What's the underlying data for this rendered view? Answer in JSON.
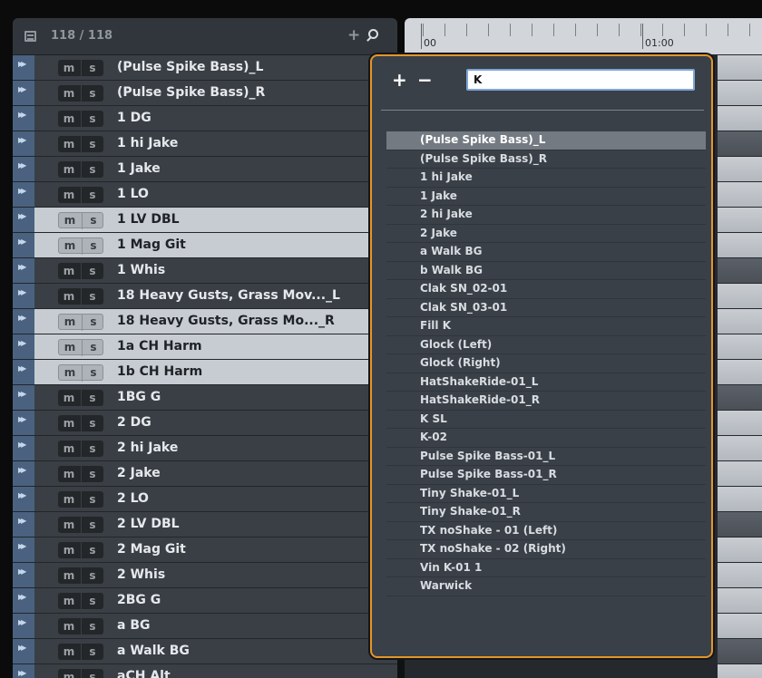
{
  "track_list": {
    "count_label": "118 / 118",
    "tracks": [
      {
        "name": "(Pulse Spike Bass)_L",
        "selected": false
      },
      {
        "name": "(Pulse Spike Bass)_R",
        "selected": false
      },
      {
        "name": "1 DG",
        "selected": false
      },
      {
        "name": "1 hi Jake",
        "selected": false
      },
      {
        "name": "1 Jake",
        "selected": false
      },
      {
        "name": "1 LO",
        "selected": false
      },
      {
        "name": "1 LV DBL",
        "selected": true
      },
      {
        "name": "1 Mag Git",
        "selected": true
      },
      {
        "name": "1 Whis",
        "selected": false
      },
      {
        "name": "18 Heavy Gusts, Grass Mov..._L",
        "selected": false
      },
      {
        "name": "18 Heavy Gusts, Grass Mo..._R",
        "selected": true
      },
      {
        "name": "1a CH Harm",
        "selected": true
      },
      {
        "name": "1b CH Harm",
        "selected": true
      },
      {
        "name": "1BG G",
        "selected": false
      },
      {
        "name": "2 DG",
        "selected": false
      },
      {
        "name": "2 hi Jake",
        "selected": false
      },
      {
        "name": "2 Jake",
        "selected": false
      },
      {
        "name": "2 LO",
        "selected": false
      },
      {
        "name": "2 LV DBL",
        "selected": false
      },
      {
        "name": "2 Mag Git",
        "selected": false
      },
      {
        "name": "2 Whis",
        "selected": false
      },
      {
        "name": "2BG G",
        "selected": false
      },
      {
        "name": "a BG",
        "selected": false
      },
      {
        "name": "a Walk BG",
        "selected": false
      },
      {
        "name": "aCH Alt",
        "selected": false
      }
    ],
    "mute_label": "m",
    "solo_label": "s"
  },
  "timeline": {
    "ruler_labels": [
      "00",
      "01:00"
    ]
  },
  "filter_popup": {
    "add_label": "+",
    "remove_label": "−",
    "filter_value": "K",
    "results": [
      "(Pulse Spike Bass)_L",
      "(Pulse Spike Bass)_R",
      "1 hi Jake",
      "1 Jake",
      "2 hi Jake",
      "2 Jake",
      "a Walk BG",
      "b Walk BG",
      "Clak SN_02-01",
      "Clak SN_03-01",
      "Fill K",
      "Glock (Left)",
      "Glock (Right)",
      "HatShakeRide-01_L",
      "HatShakeRide-01_R",
      "K SL",
      "K-02",
      "Pulse Spike Bass-01_L",
      "Pulse Spike Bass-01_R",
      "Tiny Shake-01_L",
      "Tiny Shake-01_R",
      "TX noShake - 01 (Left)",
      "TX noShake - 02 (Right)",
      "Vin K-01 1",
      "Warwick"
    ],
    "highlighted_index": 0
  },
  "colors": {
    "popup_border": "#e3962a",
    "selection_row": "#c7ccd2",
    "track_row": "#3a3f46",
    "expand_strip": "#4a6280"
  }
}
